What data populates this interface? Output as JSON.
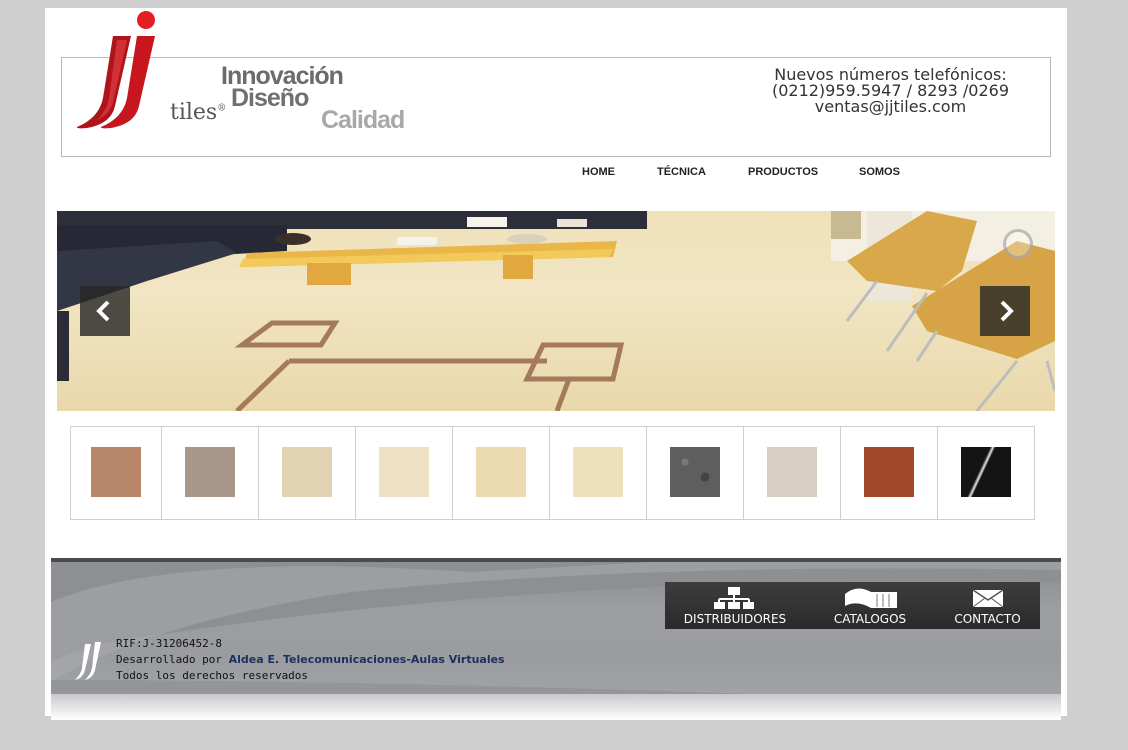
{
  "brand": {
    "logo_text": "tiles",
    "registered": "®",
    "slogan": [
      "Innovación",
      "Diseño",
      "Calidad"
    ]
  },
  "contact": {
    "line1": "Nuevos números telefónicos:",
    "line2": "(0212)959.5947 / 8293 /0269",
    "line3": "ventas@jjtiles.com"
  },
  "nav": {
    "items": [
      {
        "label": "HOME"
      },
      {
        "label": "TÉCNICA"
      },
      {
        "label": "PRODUCTOS"
      },
      {
        "label": "SOMOS"
      }
    ]
  },
  "slider": {
    "prev_icon": "chevron-left-icon",
    "next_icon": "chevron-right-icon"
  },
  "thumbnails": [
    {
      "name": "terracotta-marble",
      "color": "#b8876a"
    },
    {
      "name": "grey-beige-marble",
      "color": "#a8978a"
    },
    {
      "name": "sand-beige",
      "color": "#e2d3b4"
    },
    {
      "name": "cream",
      "color": "#efe2c4"
    },
    {
      "name": "light-cream",
      "color": "#ecdbb0"
    },
    {
      "name": "ivory-marble",
      "color": "#ece0bd"
    },
    {
      "name": "dark-grey-granite",
      "color": "#5e5e5e"
    },
    {
      "name": "light-grey-marble",
      "color": "#d6cfc2"
    },
    {
      "name": "rust-red-marble",
      "color": "#a2482a"
    },
    {
      "name": "black-marquina",
      "color": "#141414"
    }
  ],
  "footer": {
    "buttons": [
      {
        "label": "DISTRIBUIDORES",
        "icon": "network-icon"
      },
      {
        "label": "CATALOGOS",
        "icon": "book-icon"
      },
      {
        "label": "CONTACTO",
        "icon": "envelope-icon"
      }
    ],
    "rif": "RIF:J-31206452-8",
    "developed_by": "Desarrollado por",
    "developer_link": "Aldea E. Telecomunicaciones-Aulas Virtuales",
    "rights": "Todos los derechos reservados"
  }
}
